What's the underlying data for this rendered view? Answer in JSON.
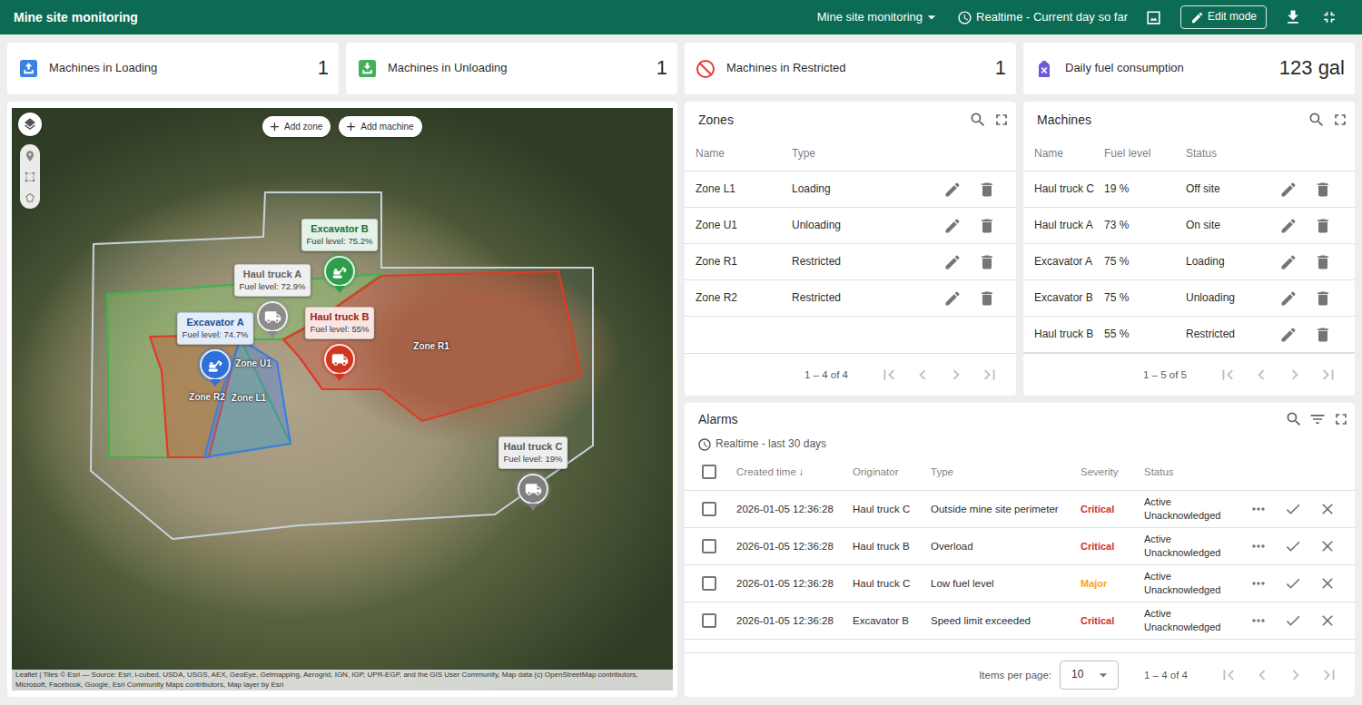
{
  "top_bar": {
    "title": "Mine site monitoring",
    "state_selector": "Mine site monitoring",
    "timewindow": "Realtime - Current day so far",
    "edit_button": "Edit mode"
  },
  "stats": [
    {
      "label": "Machines in Loading",
      "value": "1",
      "kind": "loading"
    },
    {
      "label": "Machines in Unloading",
      "value": "1",
      "kind": "unloading"
    },
    {
      "label": "Machines in Restricted",
      "value": "1",
      "kind": "restricted"
    },
    {
      "label": "Daily fuel consumption",
      "value": "123 gal",
      "kind": "fuel"
    }
  ],
  "map": {
    "buttons": [
      "Add zone",
      "Add machine"
    ],
    "zones": [
      {
        "name": "Zone R1",
        "kind": "restricted"
      },
      {
        "name": "Zone U1",
        "kind": "unloading"
      },
      {
        "name": "Zone R2",
        "kind": "restricted"
      },
      {
        "name": "Zone L1",
        "kind": "loading"
      }
    ],
    "machines": [
      {
        "name": "Excavator B",
        "reading": "Fuel level: 75.2%",
        "color": "#2e9e4a",
        "kind": "excavator"
      },
      {
        "name": "Haul truck A",
        "reading": "Fuel level: 72.9%",
        "color": "#8c8c8c",
        "kind": "truck"
      },
      {
        "name": "Excavator A",
        "reading": "Fuel level: 74.7%",
        "color": "#2f6fd8",
        "kind": "excavator"
      },
      {
        "name": "Haul truck B",
        "reading": "Fuel level: 55%",
        "color": "#d2361f",
        "kind": "truck"
      },
      {
        "name": "Haul truck C",
        "reading": "Fuel level: 19%",
        "color": "#7f7f7f",
        "kind": "truck"
      }
    ],
    "attribution": "Leaflet | Tiles © Esri — Source: Esri, i-cubed, USDA, USGS, AEX, GeoEye, Getmapping, Aerogrid, IGN, IGP, UPR-EGP, and the GIS User Community, Map data (c) OpenStreetMap contributors, Microsoft, Facebook, Google, Esri Community Maps contributors, Map layer by Esri"
  },
  "zones_table": {
    "title": "Zones",
    "columns": [
      "Name",
      "Type"
    ],
    "rows": [
      [
        "Zone L1",
        "Loading"
      ],
      [
        "Zone U1",
        "Unloading"
      ],
      [
        "Zone R1",
        "Restricted"
      ],
      [
        "Zone R2",
        "Restricted"
      ]
    ],
    "range": "1 – 4 of 4",
    "pager": [
      {
        "disabled": true
      },
      {
        "disabled": true
      },
      {
        "disabled": true
      },
      {
        "disabled": true
      }
    ]
  },
  "machines_table": {
    "title": "Machines",
    "columns": [
      "Name",
      "Fuel level",
      "Status"
    ],
    "rows": [
      [
        "Haul truck C",
        "19 %",
        "Off site"
      ],
      [
        "Haul truck A",
        "73 %",
        "On site"
      ],
      [
        "Excavator A",
        "75 %",
        "Loading"
      ],
      [
        "Excavator B",
        "75 %",
        "Unloading"
      ],
      [
        "Haul truck B",
        "55 %",
        "Restricted"
      ]
    ],
    "range": "1 – 5 of 5",
    "pager": [
      {
        "disabled": true
      },
      {
        "disabled": true
      },
      {
        "disabled": true
      },
      {
        "disabled": true
      }
    ]
  },
  "alarms": {
    "title": "Alarms",
    "subtitle": "Realtime - last 30 days",
    "select_all_checked": false,
    "columns": [
      "Created time",
      "Originator",
      "Type",
      "Severity",
      "Status"
    ],
    "sort_icon": "↓",
    "rows": [
      {
        "checked": false,
        "time": "2026-01-05 12:36:28",
        "originator": "Haul truck C",
        "type": "Outside mine site perimeter",
        "severity": "Critical",
        "severity_color": "#d32f2f",
        "status": [
          "Active",
          "Unacknowledged"
        ]
      },
      {
        "checked": false,
        "time": "2026-01-05 12:36:28",
        "originator": "Haul truck B",
        "type": "Overload",
        "severity": "Critical",
        "severity_color": "#d32f2f",
        "status": [
          "Active",
          "Unacknowledged"
        ]
      },
      {
        "checked": false,
        "time": "2026-01-05 12:36:28",
        "originator": "Haul truck C",
        "type": "Low fuel level",
        "severity": "Major",
        "severity_color": "#f5a623",
        "status": [
          "Active",
          "Unacknowledged"
        ]
      },
      {
        "checked": false,
        "time": "2026-01-05 12:36:28",
        "originator": "Excavator B",
        "type": "Speed limit exceeded",
        "severity": "Critical",
        "severity_color": "#d32f2f",
        "status": [
          "Active",
          "Unacknowledged"
        ]
      }
    ],
    "items_per_page_label": "Items per page:",
    "items_per_page": "10",
    "range": "1 – 4 of 4",
    "pager": [
      {
        "disabled": true
      },
      {
        "disabled": true
      },
      {
        "disabled": true
      },
      {
        "disabled": true
      }
    ]
  }
}
